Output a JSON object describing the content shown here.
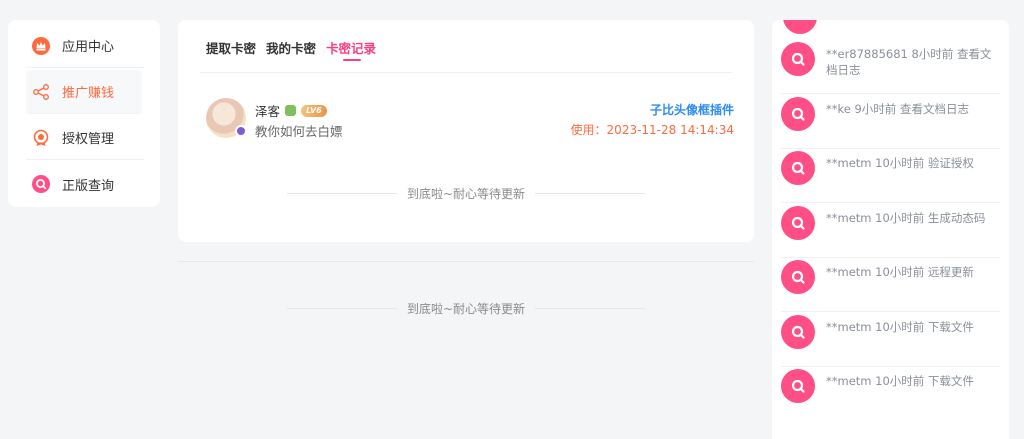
{
  "nav": {
    "items": [
      {
        "label": "应用中心",
        "icon": "crown-icon",
        "color": "#ff6a3d",
        "active": false
      },
      {
        "label": "推广赚钱",
        "icon": "share-icon",
        "color": "#ff6a3d",
        "active": true
      },
      {
        "label": "授权管理",
        "icon": "badge-icon",
        "color": "#ff6a3d",
        "active": false
      },
      {
        "label": "正版查询",
        "icon": "search-circle-icon",
        "color": "#ff4f86",
        "active": false
      }
    ]
  },
  "card": {
    "tabs": [
      "提取卡密",
      "我的卡密",
      "卡密记录"
    ],
    "active_tab": 2,
    "record": {
      "user_name": "泽客",
      "level_badge": "LV6",
      "description": "教你如何去白嫖",
      "plugin_name": "子比头像框插件",
      "used_at": "使用：2023-11-28 14:14:34"
    },
    "end_note": "到底啦~耐心等待更新"
  },
  "page_end_note": "到底啦~耐心等待更新",
  "feed": {
    "items": [
      {
        "text": "**er87885681 8小时前 查看文档日志"
      },
      {
        "text": "**ke 9小时前 查看文档日志"
      },
      {
        "text": "**metm 10小时前 验证授权"
      },
      {
        "text": "**metm 10小时前 生成动态码"
      },
      {
        "text": "**metm 10小时前 远程更新"
      },
      {
        "text": "**metm 10小时前 下载文件"
      },
      {
        "text": "**metm 10小时前 下载文件"
      }
    ]
  },
  "colors": {
    "accent": "#ff3d7f",
    "orange": "#ff6a3d",
    "link": "#2d8cf0",
    "feed_icon": "#ff4f86"
  }
}
